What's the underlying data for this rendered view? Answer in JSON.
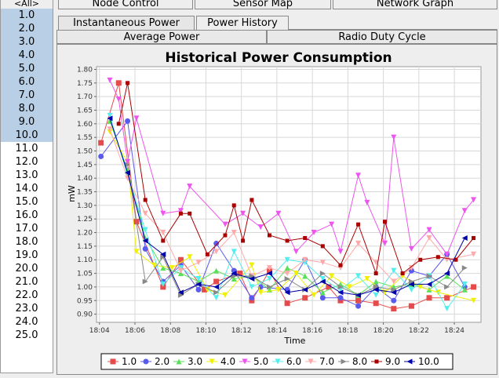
{
  "sidebar": {
    "header": "<All>",
    "items": [
      "1.0",
      "2.0",
      "3.0",
      "4.0",
      "5.0",
      "6.0",
      "7.0",
      "8.0",
      "9.0",
      "10.0",
      "11.0",
      "12.0",
      "13.0",
      "14.0",
      "15.0",
      "16.0",
      "17.0",
      "18.0",
      "19.0",
      "20.0",
      "21.0",
      "22.0",
      "23.0",
      "24.0",
      "25.0"
    ],
    "selected_count": 10
  },
  "top_tabs": [
    "Node Control",
    "Sensor Map",
    "Network Graph"
  ],
  "tabs_row1": [
    "Instantaneous Power",
    "Power History"
  ],
  "active_tab": "Power History",
  "tabs_row2": [
    "Average Power",
    "Radio Duty Cycle"
  ],
  "colors": {
    "selection": "#b8cfe5",
    "series": [
      "#e64b4b",
      "#5a5aee",
      "#5adf5a",
      "#f0f000",
      "#ee55ee",
      "#55eeee",
      "#ffaaaa",
      "#888888",
      "#aa0000",
      "#0000aa"
    ]
  },
  "chart_data": {
    "type": "line",
    "title": "Historical Power Consumption",
    "xlabel": "Time",
    "ylabel": "mW",
    "ylim": [
      0.87,
      1.81
    ],
    "xlim": [
      "18:03:50",
      "18:25:30"
    ],
    "x_ticks": [
      "18:04",
      "18:06",
      "18:08",
      "18:10",
      "18:12",
      "18:14",
      "18:16",
      "18:18",
      "18:20",
      "18:22",
      "18:24"
    ],
    "y_ticks": [
      "0.90",
      "0.95",
      "1.00",
      "1.05",
      "1.10",
      "1.15",
      "1.20",
      "1.25",
      "1.30",
      "1.35",
      "1.40",
      "1.45",
      "1.50",
      "1.55",
      "1.60",
      "1.65",
      "1.70",
      "1.75",
      "1.80"
    ],
    "legend_position": "bottom",
    "grid": true,
    "series": [
      {
        "name": "1.0",
        "marker": "square",
        "points": [
          [
            "18:04:05",
            1.53
          ],
          [
            "18:05:05",
            1.75
          ],
          [
            "18:06:05",
            1.24
          ],
          [
            "18:07:35",
            1.0
          ],
          [
            "18:08:35",
            1.1
          ],
          [
            "18:09:55",
            0.99
          ],
          [
            "18:10:35",
            1.02
          ],
          [
            "18:11:55",
            1.05
          ],
          [
            "18:12:35",
            0.95
          ],
          [
            "18:13:35",
            1.06
          ],
          [
            "18:14:35",
            0.94
          ],
          [
            "18:15:35",
            0.96
          ],
          [
            "18:16:55",
            1.0
          ],
          [
            "18:17:35",
            0.95
          ],
          [
            "18:18:35",
            0.95
          ],
          [
            "18:19:35",
            0.94
          ],
          [
            "18:20:35",
            0.92
          ],
          [
            "18:21:35",
            0.93
          ],
          [
            "18:22:35",
            0.96
          ],
          [
            "18:23:35",
            0.96
          ],
          [
            "18:25:05",
            1.0
          ]
        ]
      },
      {
        "name": "2.0",
        "marker": "circle",
        "points": [
          [
            "18:04:05",
            1.48
          ],
          [
            "18:05:35",
            1.61
          ],
          [
            "18:06:35",
            1.14
          ],
          [
            "18:07:35",
            1.02
          ],
          [
            "18:08:35",
            1.08
          ],
          [
            "18:09:35",
            0.99
          ],
          [
            "18:10:35",
            1.16
          ],
          [
            "18:11:35",
            1.06
          ],
          [
            "18:12:35",
            0.96
          ],
          [
            "18:13:05",
            1.0
          ],
          [
            "18:14:35",
            0.99
          ],
          [
            "18:15:35",
            1.1
          ],
          [
            "18:16:35",
            0.96
          ],
          [
            "18:17:35",
            0.96
          ],
          [
            "18:18:35",
            0.93
          ],
          [
            "18:19:35",
            1.0
          ],
          [
            "18:20:35",
            0.95
          ],
          [
            "18:21:35",
            1.06
          ],
          [
            "18:22:35",
            1.04
          ],
          [
            "18:23:35",
            1.12
          ],
          [
            "18:24:35",
            1.0
          ]
        ]
      },
      {
        "name": "3.0",
        "marker": "triangle-up",
        "points": [
          [
            "18:04:35",
            1.61
          ],
          [
            "18:05:35",
            1.43
          ],
          [
            "18:06:35",
            1.18
          ],
          [
            "18:07:35",
            1.07
          ],
          [
            "18:08:35",
            1.05
          ],
          [
            "18:09:35",
            1.02
          ],
          [
            "18:10:35",
            1.06
          ],
          [
            "18:11:35",
            1.03
          ],
          [
            "18:12:35",
            1.04
          ],
          [
            "18:13:35",
            0.99
          ],
          [
            "18:14:35",
            1.07
          ],
          [
            "18:15:35",
            1.04
          ],
          [
            "18:16:35",
            0.98
          ],
          [
            "18:17:35",
            1.01
          ],
          [
            "18:18:35",
            0.97
          ],
          [
            "18:19:35",
            1.02
          ],
          [
            "18:20:35",
            1.0
          ],
          [
            "18:21:35",
            1.01
          ],
          [
            "18:22:35",
            0.99
          ],
          [
            "18:23:35",
            1.04
          ],
          [
            "18:24:35",
            0.99
          ]
        ]
      },
      {
        "name": "4.0",
        "marker": "triangle-down",
        "points": [
          [
            "18:04:35",
            1.57
          ],
          [
            "18:05:35",
            1.46
          ],
          [
            "18:06:05",
            1.13
          ],
          [
            "18:07:05",
            1.08
          ],
          [
            "18:08:05",
            1.07
          ],
          [
            "18:09:05",
            1.11
          ],
          [
            "18:10:05",
            0.99
          ],
          [
            "18:11:05",
            0.97
          ],
          [
            "18:12:35",
            1.08
          ],
          [
            "18:13:05",
            0.98
          ],
          [
            "18:14:05",
            0.99
          ],
          [
            "18:15:05",
            1.05
          ],
          [
            "18:16:05",
            0.97
          ],
          [
            "18:17:05",
            1.04
          ],
          [
            "18:18:05",
            1.0
          ],
          [
            "18:19:05",
            1.03
          ],
          [
            "18:20:05",
            0.98
          ],
          [
            "18:21:05",
            1.04
          ],
          [
            "18:22:05",
            1.0
          ],
          [
            "18:23:05",
            0.98
          ],
          [
            "18:25:05",
            0.95
          ]
        ]
      },
      {
        "name": "5.0",
        "marker": "triangle-down",
        "points": [
          [
            "18:04:35",
            1.76
          ],
          [
            "18:05:05",
            1.69
          ],
          [
            "18:05:35",
            1.46
          ],
          [
            "18:06:05",
            1.62
          ],
          [
            "18:07:35",
            1.27
          ],
          [
            "18:08:35",
            1.28
          ],
          [
            "18:09:05",
            1.37
          ],
          [
            "18:11:05",
            1.23
          ],
          [
            "18:12:05",
            1.27
          ],
          [
            "18:13:05",
            1.22
          ],
          [
            "18:14:05",
            1.27
          ],
          [
            "18:15:05",
            1.13
          ],
          [
            "18:16:05",
            1.2
          ],
          [
            "18:17:05",
            1.23
          ],
          [
            "18:17:35",
            1.13
          ],
          [
            "18:18:35",
            1.41
          ],
          [
            "18:19:05",
            1.31
          ],
          [
            "18:20:05",
            1.16
          ],
          [
            "18:20:35",
            1.55
          ],
          [
            "18:21:35",
            1.14
          ],
          [
            "18:22:35",
            1.21
          ],
          [
            "18:23:35",
            1.12
          ],
          [
            "18:24:35",
            1.28
          ],
          [
            "18:25:05",
            1.32
          ]
        ]
      },
      {
        "name": "6.0",
        "marker": "triangle-down",
        "points": [
          [
            "18:04:35",
            1.63
          ],
          [
            "18:05:35",
            1.41
          ],
          [
            "18:06:35",
            1.21
          ],
          [
            "18:07:35",
            1.01
          ],
          [
            "18:08:35",
            1.07
          ],
          [
            "18:09:35",
            1.03
          ],
          [
            "18:10:35",
            0.96
          ],
          [
            "18:11:35",
            1.13
          ],
          [
            "18:12:35",
            1.0
          ],
          [
            "18:13:35",
            1.03
          ],
          [
            "18:14:35",
            1.1
          ],
          [
            "18:15:35",
            1.09
          ],
          [
            "18:16:35",
            1.03
          ],
          [
            "18:17:35",
            0.99
          ],
          [
            "18:18:35",
            1.04
          ],
          [
            "18:19:35",
            0.97
          ],
          [
            "18:20:35",
            1.06
          ],
          [
            "18:21:35",
            0.99
          ],
          [
            "18:22:35",
            1.04
          ],
          [
            "18:23:35",
            0.92
          ],
          [
            "18:24:35",
            1.01
          ]
        ]
      },
      {
        "name": "7.0",
        "marker": "triangle-down",
        "points": [
          [
            "18:04:35",
            1.58
          ],
          [
            "18:05:35",
            1.4
          ],
          [
            "18:06:35",
            1.27
          ],
          [
            "18:07:35",
            1.2
          ],
          [
            "18:08:35",
            1.06
          ],
          [
            "18:09:35",
            1.09
          ],
          [
            "18:10:35",
            1.13
          ],
          [
            "18:11:35",
            1.2
          ],
          [
            "18:12:35",
            1.04
          ],
          [
            "18:13:35",
            1.07
          ],
          [
            "18:14:35",
            1.05
          ],
          [
            "18:15:35",
            1.1
          ],
          [
            "18:16:35",
            1.09
          ],
          [
            "18:17:35",
            1.07
          ],
          [
            "18:18:35",
            1.16
          ],
          [
            "18:19:35",
            1.09
          ],
          [
            "18:20:35",
            1.02
          ],
          [
            "18:21:35",
            1.07
          ],
          [
            "18:22:35",
            1.18
          ],
          [
            "18:23:35",
            1.1
          ],
          [
            "18:25:05",
            1.12
          ]
        ]
      },
      {
        "name": "8.0",
        "marker": "triangle-right",
        "points": [
          [
            "18:05:35",
            1.45
          ],
          [
            "18:06:35",
            1.02
          ],
          [
            "18:07:35",
            1.11
          ],
          [
            "18:08:35",
            0.97
          ],
          [
            "18:09:35",
            1.01
          ],
          [
            "18:10:35",
            0.98
          ],
          [
            "18:11:35",
            1.04
          ],
          [
            "18:12:35",
            1.04
          ],
          [
            "18:13:35",
            1.0
          ],
          [
            "18:14:35",
            1.03
          ],
          [
            "18:15:35",
            0.99
          ],
          [
            "18:16:35",
            1.05
          ],
          [
            "18:17:35",
            1.0
          ],
          [
            "18:18:35",
            0.97
          ],
          [
            "18:19:35",
            1.0
          ],
          [
            "18:20:35",
            0.99
          ],
          [
            "18:21:35",
            1.02
          ],
          [
            "18:22:35",
            1.04
          ],
          [
            "18:23:35",
            1.0
          ],
          [
            "18:24:35",
            1.07
          ]
        ]
      },
      {
        "name": "9.0",
        "marker": "square-small",
        "points": [
          [
            "18:05:05",
            1.6
          ],
          [
            "18:05:35",
            1.75
          ],
          [
            "18:06:35",
            1.32
          ],
          [
            "18:07:35",
            1.17
          ],
          [
            "18:08:35",
            1.27
          ],
          [
            "18:09:05",
            1.27
          ],
          [
            "18:10:05",
            1.12
          ],
          [
            "18:11:05",
            1.19
          ],
          [
            "18:11:35",
            1.3
          ],
          [
            "18:12:05",
            1.17
          ],
          [
            "18:12:35",
            1.32
          ],
          [
            "18:13:35",
            1.19
          ],
          [
            "18:14:35",
            1.17
          ],
          [
            "18:15:35",
            1.18
          ],
          [
            "18:16:35",
            1.15
          ],
          [
            "18:17:35",
            1.08
          ],
          [
            "18:18:35",
            1.23
          ],
          [
            "18:19:35",
            1.05
          ],
          [
            "18:20:05",
            1.24
          ],
          [
            "18:21:05",
            1.05
          ],
          [
            "18:22:05",
            1.1
          ],
          [
            "18:23:05",
            1.11
          ],
          [
            "18:24:05",
            1.1
          ],
          [
            "18:25:05",
            1.18
          ]
        ]
      },
      {
        "name": "10.0",
        "marker": "triangle-left",
        "points": [
          [
            "18:04:35",
            1.62
          ],
          [
            "18:05:35",
            1.42
          ],
          [
            "18:06:35",
            1.17
          ],
          [
            "18:07:35",
            1.12
          ],
          [
            "18:08:35",
            0.98
          ],
          [
            "18:09:35",
            1.01
          ],
          [
            "18:10:35",
            1.0
          ],
          [
            "18:11:35",
            1.05
          ],
          [
            "18:12:35",
            1.03
          ],
          [
            "18:13:35",
            1.05
          ],
          [
            "18:14:35",
            0.98
          ],
          [
            "18:15:35",
            0.99
          ],
          [
            "18:16:35",
            1.02
          ],
          [
            "18:17:35",
            0.98
          ],
          [
            "18:18:35",
            0.97
          ],
          [
            "18:19:35",
            0.99
          ],
          [
            "18:20:35",
            0.98
          ],
          [
            "18:21:35",
            1.01
          ],
          [
            "18:22:35",
            1.01
          ],
          [
            "18:23:35",
            1.05
          ],
          [
            "18:24:35",
            1.18
          ]
        ]
      }
    ]
  }
}
